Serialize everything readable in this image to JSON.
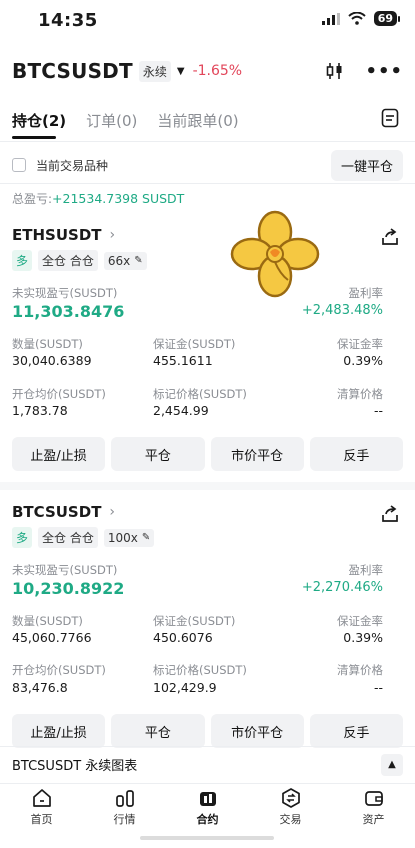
{
  "status": {
    "time": "14:35",
    "battery": "69"
  },
  "header": {
    "symbol": "BTCSUSDT",
    "type_tag": "永续",
    "change": "-1.65%"
  },
  "tabs": [
    {
      "label": "持仓(2)",
      "active": true
    },
    {
      "label": "订单(0)",
      "active": false
    },
    {
      "label": "当前跟单(0)",
      "active": false
    }
  ],
  "filter": {
    "label": "当前交易品种",
    "close_all": "一键平仓"
  },
  "total_pnl": {
    "label": "总盈亏:",
    "value": "+21534.7398 SUSDT"
  },
  "positions": [
    {
      "symbol": "ETHSUSDT",
      "side": "多",
      "margin_mode": "全仓 合仓",
      "leverage": "66x",
      "unrealized_label": "未实现盈亏(SUSDT)",
      "unrealized_value": "11,303.8476",
      "roe_label": "盈利率",
      "roe_value": "+2,483.48%",
      "qty_label": "数量(SUSDT)",
      "qty_value": "30,040.6389",
      "margin_label": "保证金(SUSDT)",
      "margin_value": "455.1611",
      "margin_ratio_label": "保证金率",
      "margin_ratio_value": "0.39%",
      "entry_label": "开仓均价(SUSDT)",
      "entry_value": "1,783.78",
      "mark_label": "标记价格(SUSDT)",
      "mark_value": "2,454.99",
      "liq_label": "清算价格",
      "liq_value": "--",
      "buttons": [
        "止盈/止损",
        "平仓",
        "市价平仓",
        "反手"
      ]
    },
    {
      "symbol": "BTCSUSDT",
      "side": "多",
      "margin_mode": "全仓 合仓",
      "leverage": "100x",
      "unrealized_label": "未实现盈亏(SUSDT)",
      "unrealized_value": "10,230.8922",
      "roe_label": "盈利率",
      "roe_value": "+2,270.46%",
      "qty_label": "数量(SUSDT)",
      "qty_value": "45,060.7766",
      "margin_label": "保证金(SUSDT)",
      "margin_value": "450.6076",
      "margin_ratio_label": "保证金率",
      "margin_ratio_value": "0.39%",
      "entry_label": "开仓均价(SUSDT)",
      "entry_value": "83,476.8",
      "mark_label": "标记价格(SUSDT)",
      "mark_value": "102,429.9",
      "liq_label": "清算价格",
      "liq_value": "--",
      "buttons": [
        "止盈/止损",
        "平仓",
        "市价平仓",
        "反手"
      ]
    }
  ],
  "chart_bar": {
    "label": "BTCSUSDT 永续图表"
  },
  "nav": [
    {
      "label": "首页",
      "icon": "home-icon"
    },
    {
      "label": "行情",
      "icon": "market-icon"
    },
    {
      "label": "合约",
      "icon": "futures-icon"
    },
    {
      "label": "交易",
      "icon": "trade-icon"
    },
    {
      "label": "资产",
      "icon": "wallet-icon"
    }
  ],
  "colors": {
    "green": "#1faa85",
    "red": "#e2465a",
    "sticker": "#f5c842"
  }
}
